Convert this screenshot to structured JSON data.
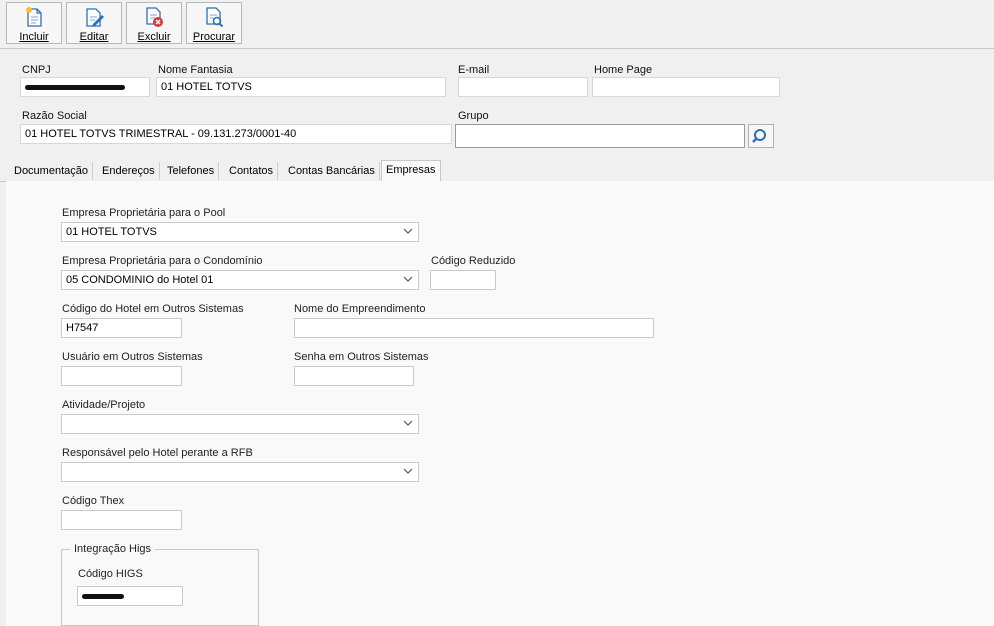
{
  "toolbar": {
    "incluir": "Incluir",
    "editar": "Editar",
    "excluir": "Excluir",
    "procurar": "Procurar"
  },
  "header": {
    "cnpj_label": "CNPJ",
    "nome_fantasia_label": "Nome Fantasia",
    "nome_fantasia_value": "01 HOTEL TOTVS",
    "email_label": "E-mail",
    "email_value": "",
    "home_page_label": "Home Page",
    "home_page_value": "",
    "razao_social_label": "Razão Social",
    "razao_social_value": "01 HOTEL TOTVS TRIMESTRAL - 09.131.273/0001-40",
    "grupo_label": "Grupo",
    "grupo_value": ""
  },
  "tabs": [
    "Documentação",
    "Endereços",
    "Telefones",
    "Contatos",
    "Contas Bancárias",
    "Empresas"
  ],
  "active_tab": "Empresas",
  "empresas": {
    "pool_label": "Empresa Proprietária para o Pool",
    "pool_value": "01 HOTEL TOTVS",
    "condominio_label": "Empresa Proprietária para o Condomínio",
    "condominio_value": "05 CONDOMINIO do Hotel 01",
    "codigo_reduzido_label": "Código Reduzido",
    "codigo_reduzido_value": "",
    "codigo_hotel_label": "Código do Hotel em Outros Sistemas",
    "codigo_hotel_value": "H7547",
    "nome_empreendimento_label": "Nome do Empreendimento",
    "nome_empreendimento_value": "",
    "usuario_label": "Usuário em Outros Sistemas",
    "usuario_value": "",
    "senha_label": "Senha em Outros Sistemas",
    "senha_value": "",
    "atividade_label": "Atividade/Projeto",
    "atividade_value": "",
    "responsavel_label": "Responsável pelo Hotel perante a RFB",
    "responsavel_value": "",
    "codigo_thex_label": "Código Thex",
    "codigo_thex_value": "",
    "integracao_title": "Integração Higs",
    "codigo_higs_label": "Código HIGS"
  },
  "icons": {
    "incluir": "new-document-icon",
    "editar": "edit-document-icon",
    "excluir": "delete-document-icon",
    "procurar": "search-document-icon",
    "grupo_search": "search-icon",
    "dropdown": "chevron-down-icon"
  },
  "colors": {
    "window_bg": "#f0f0f0",
    "tab_panel_bg": "#f9f9f9",
    "icon_blue": "#2c6fb5",
    "delete_red": "#d23b2f"
  }
}
